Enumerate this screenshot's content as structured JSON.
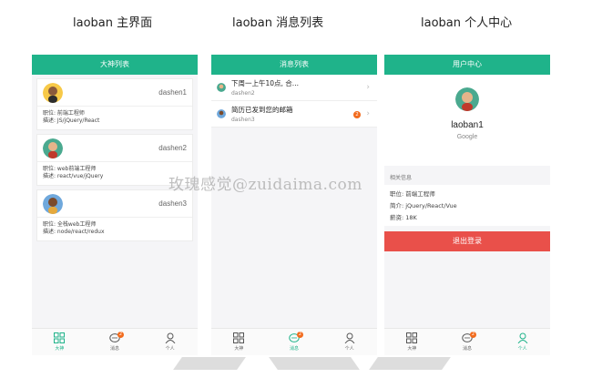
{
  "captions": [
    "laoban 主界面",
    "laoban 消息列表",
    "laoban 个人中心"
  ],
  "screen1": {
    "header": "大神列表",
    "cards": [
      {
        "name": "dashen1",
        "job": "职位: 前端工程师",
        "desc": "描述: JS/jQuery/React",
        "avatar_color": "#f7c948"
      },
      {
        "name": "dashen2",
        "job": "职位: web前端工程师",
        "desc": "描述: react/vue/jQuery",
        "avatar_color": "#4aa98f"
      },
      {
        "name": "dashen3",
        "job": "职位: 全栈web工程师",
        "desc": "描述: node/react/redux",
        "avatar_color": "#6fa8dc"
      }
    ]
  },
  "screen2": {
    "header": "消息列表",
    "messages": [
      {
        "title": "下周一上午10点, 合...",
        "from": "dashen2",
        "badge": ""
      },
      {
        "title": "简历已发到您的邮箱",
        "from": "dashen3",
        "badge": "2"
      }
    ]
  },
  "screen3": {
    "header": "用户中心",
    "name": "laoban1",
    "company": "Google",
    "section_title": "相关信息",
    "info": [
      "职位: 前端工程师",
      "简介: jQuery/React/Vue",
      "薪资: 18K"
    ],
    "logout": "退出登录"
  },
  "tabbar": {
    "tabs": [
      "大神",
      "消息",
      "个人"
    ],
    "message_badge": "2",
    "icons": [
      "grid-icon",
      "chat-icon",
      "user-icon"
    ]
  },
  "watermark": "玫瑰感觉@zuidaima.com",
  "colors": {
    "accent": "#1fb38a",
    "danger": "#e9504a",
    "badge": "#f26b1d"
  }
}
